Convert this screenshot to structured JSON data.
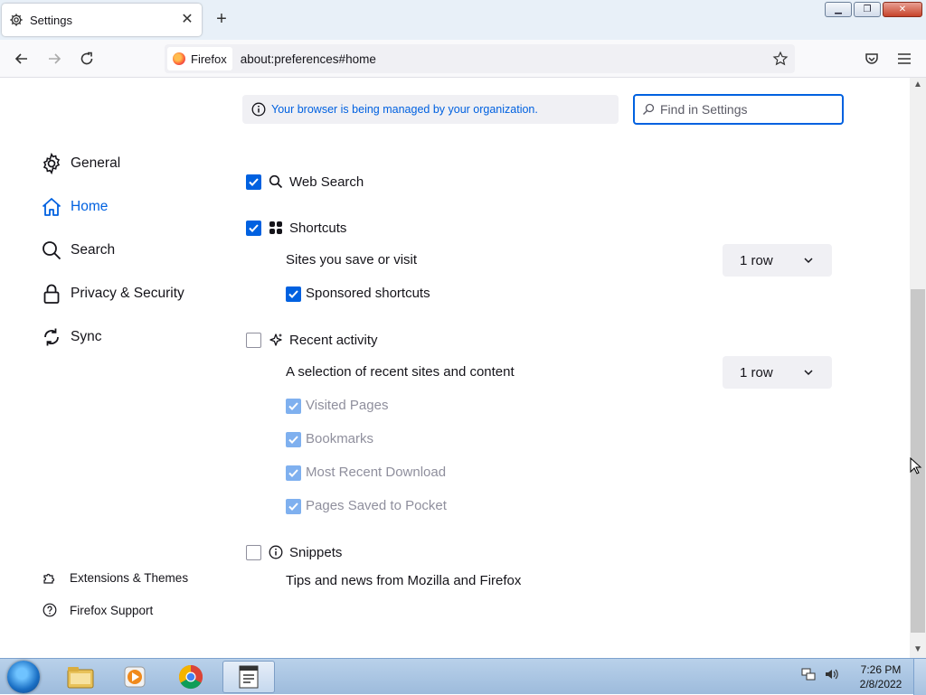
{
  "browser": {
    "tab": {
      "title": "Settings",
      "icon": "gear-icon",
      "close_icon": "close-icon"
    },
    "new_tab_icon": "plus-icon",
    "window_controls": [
      "minimize-icon",
      "restore-icon",
      "close-icon"
    ],
    "nav": {
      "back_icon": "back-arrow-icon",
      "forward_icon": "forward-arrow-icon",
      "reload_icon": "reload-icon"
    },
    "identity_label": "Firefox",
    "url": "about:preferences#home",
    "bookmark_icon": "star-icon",
    "pocket_icon": "pocket-icon",
    "menu_icon": "hamburger-menu-icon"
  },
  "policy_notice": "Your browser is being managed by your organization.",
  "search": {
    "placeholder": "Find in Settings",
    "value": ""
  },
  "sidebar": {
    "items": [
      {
        "label": "General",
        "icon": "gear-icon",
        "selected": false
      },
      {
        "label": "Home",
        "icon": "home-icon",
        "selected": true
      },
      {
        "label": "Search",
        "icon": "search-icon",
        "selected": false
      },
      {
        "label": "Privacy & Security",
        "icon": "lock-icon",
        "selected": false
      },
      {
        "label": "Sync",
        "icon": "sync-icon",
        "selected": false
      }
    ],
    "footer": [
      {
        "label": "Extensions & Themes",
        "icon": "puzzle-icon"
      },
      {
        "label": "Firefox Support",
        "icon": "help-icon"
      }
    ]
  },
  "home_content": {
    "web_search": {
      "label": "Web Search",
      "checked": true
    },
    "shortcuts": {
      "label": "Shortcuts",
      "checked": true,
      "rows_label": "Sites you save or visit",
      "rows_value": "1 row",
      "sponsored": {
        "label": "Sponsored shortcuts",
        "checked": true
      }
    },
    "recent_activity": {
      "label": "Recent activity",
      "checked": false,
      "rows_label": "A selection of recent sites and content",
      "rows_value": "1 row",
      "options": [
        {
          "label": "Visited Pages",
          "checked": true,
          "disabled": true
        },
        {
          "label": "Bookmarks",
          "checked": true,
          "disabled": true
        },
        {
          "label": "Most Recent Download",
          "checked": true,
          "disabled": true
        },
        {
          "label": "Pages Saved to Pocket",
          "checked": true,
          "disabled": true
        }
      ]
    },
    "snippets": {
      "label": "Snippets",
      "checked": false,
      "description": "Tips and news from Mozilla and Firefox"
    }
  },
  "taskbar": {
    "apps": [
      "windows-explorer-icon",
      "media-player-icon",
      "chrome-icon",
      "app-window-icon"
    ],
    "clock": {
      "time": "7:26 PM",
      "date": "2/8/2022"
    }
  },
  "colors": {
    "accent": "#0061e0",
    "text": "#15141a",
    "muted": "#8f8f9d",
    "chip": "#f0f0f4"
  }
}
